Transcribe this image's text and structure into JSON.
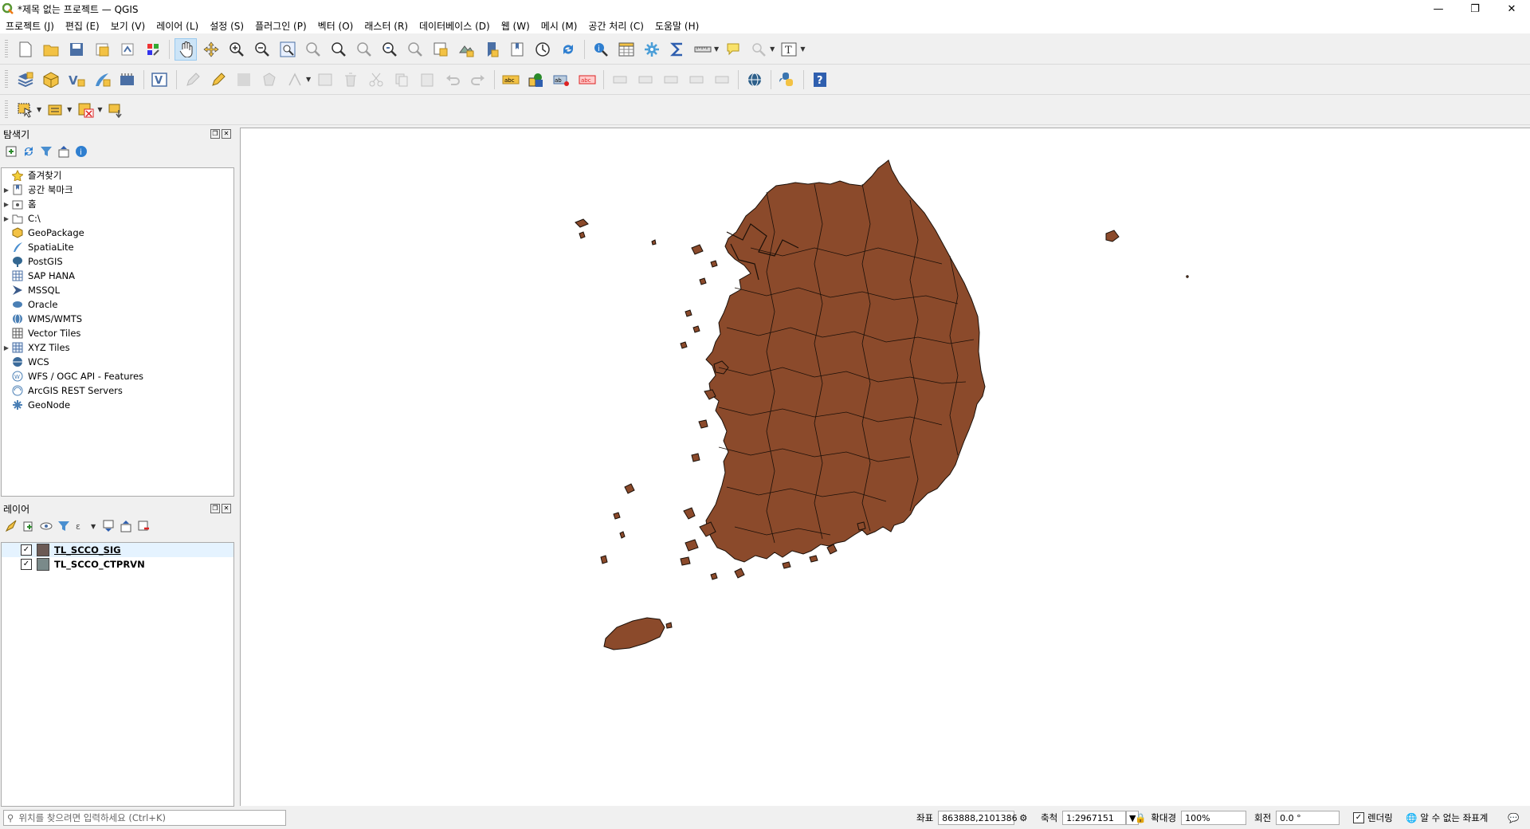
{
  "window": {
    "title": "*제목 없는 프로젝트 — QGIS",
    "controls": [
      "—",
      "❐",
      "✕"
    ]
  },
  "menu": [
    "프로젝트 (J)",
    "편집 (E)",
    "보기 (V)",
    "레이어 (L)",
    "설정 (S)",
    "플러그인 (P)",
    "벡터 (O)",
    "래스터 (R)",
    "데이터베이스 (D)",
    "웹 (W)",
    "메시 (M)",
    "공간 처리 (C)",
    "도움말 (H)"
  ],
  "browser": {
    "title": "탐색기",
    "items": [
      {
        "label": "즐겨찾기",
        "icon": "star-icon",
        "expand": false
      },
      {
        "label": "공간 북마크",
        "icon": "bookmark-icon",
        "expand": true
      },
      {
        "label": "홈",
        "icon": "home-folder-icon",
        "expand": true
      },
      {
        "label": "C:\\",
        "icon": "folder-icon",
        "expand": true
      },
      {
        "label": "GeoPackage",
        "icon": "geopackage-icon",
        "expand": false
      },
      {
        "label": "SpatiaLite",
        "icon": "spatialite-icon",
        "expand": false
      },
      {
        "label": "PostGIS",
        "icon": "postgis-icon",
        "expand": false
      },
      {
        "label": "SAP HANA",
        "icon": "hana-icon",
        "expand": false
      },
      {
        "label": "MSSQL",
        "icon": "mssql-icon",
        "expand": false
      },
      {
        "label": "Oracle",
        "icon": "oracle-icon",
        "expand": false
      },
      {
        "label": "WMS/WMTS",
        "icon": "wms-icon",
        "expand": false
      },
      {
        "label": "Vector Tiles",
        "icon": "vector-tiles-icon",
        "expand": false
      },
      {
        "label": "XYZ Tiles",
        "icon": "xyz-tiles-icon",
        "expand": true
      },
      {
        "label": "WCS",
        "icon": "wcs-icon",
        "expand": false
      },
      {
        "label": "WFS / OGC API - Features",
        "icon": "wfs-icon",
        "expand": false
      },
      {
        "label": "ArcGIS REST Servers",
        "icon": "arcgis-icon",
        "expand": false
      },
      {
        "label": "GeoNode",
        "icon": "geonode-icon",
        "expand": false
      }
    ]
  },
  "layers": {
    "title": "레이어",
    "items": [
      {
        "label": "TL_SCCO_SIG",
        "checked": "✓",
        "color": "#6b5a55"
      },
      {
        "label": "TL_SCCO_CTPRVN",
        "checked": "✓",
        "color": "#7a8a8a"
      }
    ]
  },
  "status": {
    "locator_placeholder": "위치를 찾으려면 입력하세요 (Ctrl+K)",
    "coord_label": "좌표",
    "coord_value": "863888,2101386",
    "scale_label": "축척",
    "scale_value": "1:2967151",
    "magnifier_label": "확대경",
    "magnifier_value": "100%",
    "rotation_label": "회전",
    "rotation_value": "0.0 °",
    "render_label": "렌더링",
    "crs_label": "알 수 없는 좌표계"
  },
  "colors": {
    "land": "#8b4a2b",
    "outline": "#1a0f08"
  }
}
